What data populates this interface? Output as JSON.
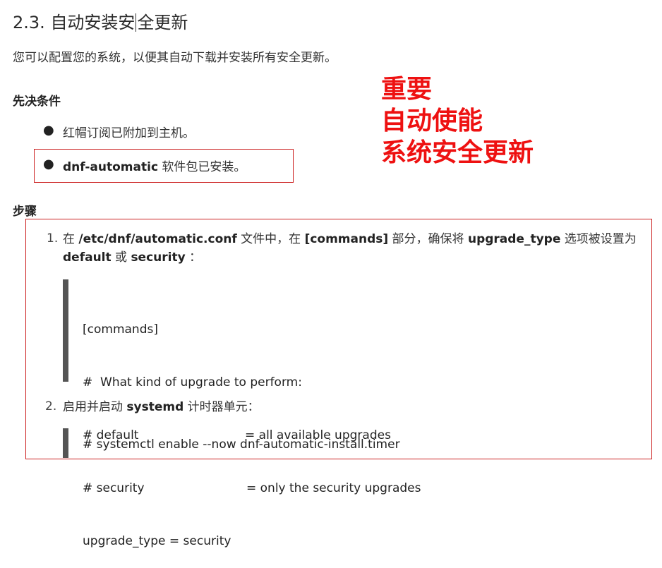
{
  "section": {
    "number": "2.3.",
    "title_before_cursor": "自动安装安",
    "title_after_cursor": "全更新"
  },
  "intro": "您可以配置您的系统，以便其自动下载并安装所有安全更新。",
  "prerequisites": {
    "heading": "先决条件",
    "items": [
      {
        "text": "红帽订阅已附加到主机。"
      },
      {
        "bold": "dnf-automatic",
        "text": " 软件包已安装。"
      }
    ]
  },
  "annotation": {
    "lines": [
      "重要",
      "自动使能",
      "系统安全更新"
    ],
    "color": "#ee1111"
  },
  "steps": {
    "heading": "步骤",
    "step1": {
      "num": "1.",
      "t1": "在 ",
      "b1": "/etc/dnf/automatic.conf",
      "t2": " 文件中，在 ",
      "b2": "[commands]",
      "t3": " 部分，确保将 ",
      "b3": "upgrade_type",
      "t4": " 选项被设置为 ",
      "b4": "default",
      "t5": " 或 ",
      "b5": "security",
      "t6": " ："
    },
    "code1": {
      "l1": "[commands]",
      "l2": "#  What kind of upgrade to perform:",
      "l3a": "# default",
      "l3b": "= all available upgrades",
      "l4a": "# security",
      "l4b": "= only the security upgrades",
      "l5": "upgrade_type = security"
    },
    "step2": {
      "num": "2.",
      "t1": "启用并启动 ",
      "b1": "systemd",
      "t2": " 计时器单元："
    },
    "code2": "# systemctl enable --now dnf-automatic-install.timer"
  },
  "colors": {
    "highlight_box": "#cc2222",
    "code_bar": "#555555"
  }
}
